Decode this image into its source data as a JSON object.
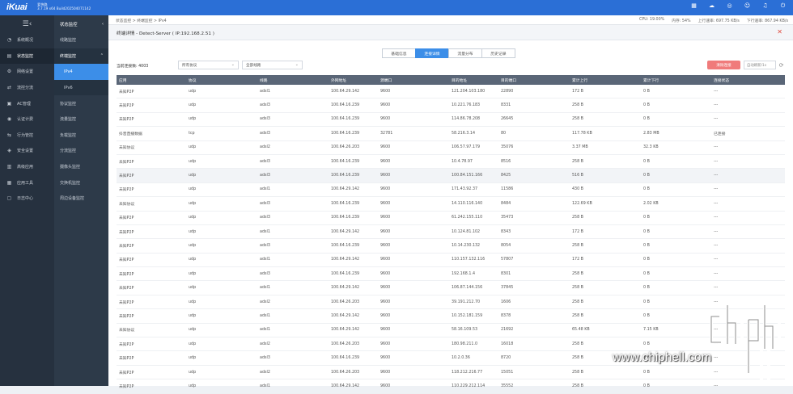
{
  "topbar": {
    "logo": "iKuai",
    "brand_line1": "爱快路",
    "brand_line2": "3.7.19 x64 Build202504071142",
    "icons": [
      "grid-icon",
      "cloud-icon",
      "globe-icon",
      "user-icon",
      "bell-icon",
      "power-icon"
    ]
  },
  "leftnav": {
    "toggle": "☰‹",
    "items": [
      {
        "label": "系统概况",
        "icon": "dashboard-icon"
      },
      {
        "label": "状态监控",
        "icon": "chart-icon",
        "active": true
      },
      {
        "label": "网络设置",
        "icon": "network-icon"
      },
      {
        "label": "流控分流",
        "icon": "flow-icon"
      },
      {
        "label": "AC管理",
        "icon": "ac-icon"
      },
      {
        "label": "认证计费",
        "icon": "auth-icon"
      },
      {
        "label": "行为管控",
        "icon": "behavior-icon"
      },
      {
        "label": "安全设置",
        "icon": "shield-icon"
      },
      {
        "label": "高级应用",
        "icon": "advanced-icon"
      },
      {
        "label": "应用工具",
        "icon": "tools-icon"
      },
      {
        "label": "日志中心",
        "icon": "log-icon"
      }
    ]
  },
  "subnav": {
    "title": "状态监控",
    "collapse": "‹",
    "items": [
      {
        "label": "线路监控",
        "kind": "normal"
      },
      {
        "label": "终端监控",
        "kind": "open",
        "caret": "⌃"
      },
      {
        "label": "IPv4",
        "kind": "sel"
      },
      {
        "label": "IPv6",
        "kind": "child"
      },
      {
        "label": "协议监控",
        "kind": "normal"
      },
      {
        "label": "流量监控",
        "kind": "normal"
      },
      {
        "label": "负载监控",
        "kind": "normal"
      },
      {
        "label": "分流监控",
        "kind": "normal"
      },
      {
        "label": "摄像头监控",
        "kind": "normal"
      },
      {
        "label": "交换机监控",
        "kind": "normal"
      },
      {
        "label": "周边设备监控",
        "kind": "normal"
      }
    ]
  },
  "breadcrumb": {
    "text": "状态监控 > 终端监控 > IPv4"
  },
  "stats": {
    "cpu": "CPU: 19.00%",
    "mem": "内存: 54%",
    "up": "上行速率: 697.75 KB/s",
    "down": "下行速率: 867.94 KB/s"
  },
  "panel": {
    "title": "终端详情 - Detect-Server ( IP:192.168.2.51 )",
    "close": "✕",
    "tabs": [
      {
        "label": "基础信息"
      },
      {
        "label": "连接详情",
        "active": true
      },
      {
        "label": "流量分布"
      },
      {
        "label": "历史记录"
      }
    ],
    "filters": {
      "conn_count": "当前连接数: 4003",
      "protocol_select": "所有协议",
      "line_select": "全部线路",
      "clear_button": "清除连接",
      "refresh_select": "自动刷新/1s",
      "refresh_icon": "⟳"
    }
  },
  "table": {
    "headers": [
      "应用",
      "协议",
      "线路",
      "外网地址",
      "源端口",
      "目的地址",
      "目的端口",
      "累计上行",
      "累计下行",
      "连接状态"
    ],
    "rows": [
      [
        "未知P2P",
        "udp",
        "adsl1",
        "100.64.29.142",
        "9600",
        "121.204.103.180",
        "22890",
        "172 B",
        "0 B",
        "---"
      ],
      [
        "未知P2P",
        "udp",
        "adsl3",
        "100.64.16.239",
        "9600",
        "10.221.76.183",
        "8331",
        "258 B",
        "0 B",
        "---"
      ],
      [
        "未知P2P",
        "udp",
        "adsl3",
        "100.64.16.239",
        "9600",
        "114.86.78.208",
        "26645",
        "258 B",
        "0 B",
        "---"
      ],
      [
        "抖音直播数据",
        "tcp",
        "adsl3",
        "100.64.16.239",
        "32781",
        "58.216.3.14",
        "80",
        "117.78 KB",
        "2.83 MB",
        "已连接"
      ],
      [
        "未知协议",
        "udp",
        "adsl2",
        "100.64.26.203",
        "9600",
        "106.57.97.179",
        "35076",
        "3.37 MB",
        "32.3 KB",
        "---"
      ],
      [
        "未知P2P",
        "udp",
        "adsl3",
        "100.64.16.239",
        "9600",
        "10.4.78.97",
        "8516",
        "258 B",
        "0 B",
        "---"
      ],
      [
        "未知P2P",
        "udp",
        "adsl3",
        "100.64.16.239",
        "9600",
        "100.84.151.166",
        "8425",
        "516 B",
        "0 B",
        "---"
      ],
      [
        "未知P2P",
        "udp",
        "adsl1",
        "100.64.29.142",
        "9600",
        "171.43.92.37",
        "11586",
        "430 B",
        "0 B",
        "---"
      ],
      [
        "未知协议",
        "udp",
        "adsl3",
        "100.64.16.239",
        "9600",
        "14.110.116.140",
        "8484",
        "122.69 KB",
        "2.02 KB",
        "---"
      ],
      [
        "未知P2P",
        "udp",
        "adsl3",
        "100.64.16.239",
        "9600",
        "61.242.155.110",
        "35473",
        "258 B",
        "0 B",
        "---"
      ],
      [
        "未知P2P",
        "udp",
        "adsl1",
        "100.64.29.142",
        "9600",
        "10.124.81.102",
        "8343",
        "172 B",
        "0 B",
        "---"
      ],
      [
        "未知P2P",
        "udp",
        "adsl3",
        "100.64.16.239",
        "9600",
        "10.14.230.132",
        "8054",
        "258 B",
        "0 B",
        "---"
      ],
      [
        "未知P2P",
        "udp",
        "adsl1",
        "100.64.29.142",
        "9600",
        "110.157.132.116",
        "57807",
        "172 B",
        "0 B",
        "---"
      ],
      [
        "未知P2P",
        "udp",
        "adsl3",
        "100.64.16.239",
        "9600",
        "192.168.1.4",
        "8301",
        "258 B",
        "0 B",
        "---"
      ],
      [
        "未知P2P",
        "udp",
        "adsl1",
        "100.64.29.142",
        "9600",
        "106.87.144.156",
        "37845",
        "258 B",
        "0 B",
        "---"
      ],
      [
        "未知P2P",
        "udp",
        "adsl2",
        "100.64.26.203",
        "9600",
        "39.191.212.70",
        "1606",
        "258 B",
        "0 B",
        "---"
      ],
      [
        "未知P2P",
        "udp",
        "adsl1",
        "100.64.29.142",
        "9600",
        "10.152.181.159",
        "8378",
        "258 B",
        "0 B",
        "---"
      ],
      [
        "未知协议",
        "udp",
        "adsl1",
        "100.64.29.142",
        "9600",
        "58.16.109.53",
        "21692",
        "65.48 KB",
        "7.15 KB",
        "---"
      ],
      [
        "未知P2P",
        "udp",
        "adsl2",
        "100.64.26.203",
        "9600",
        "180.98.211.0",
        "16018",
        "258 B",
        "0 B",
        "---"
      ],
      [
        "未知P2P",
        "udp",
        "adsl3",
        "100.64.16.239",
        "9600",
        "10.2.0.36",
        "8720",
        "258 B",
        "0 B",
        "---"
      ],
      [
        "未知P2P",
        "udp",
        "adsl2",
        "100.64.26.203",
        "9600",
        "118.212.216.77",
        "15051",
        "258 B",
        "0 B",
        "---"
      ],
      [
        "未知P2P",
        "udp",
        "adsl1",
        "100.64.29.142",
        "9600",
        "110.229.212.114",
        "35552",
        "258 B",
        "0 B",
        "---"
      ]
    ],
    "highlight_row": 6
  },
  "watermark": {
    "text": "chip hell",
    "url": "www.chiphell.com"
  },
  "colors": {
    "topbar": "#2b6fd6",
    "accent": "#3c8ee8",
    "danger": "#f07b7b",
    "header_row": "#5a6677",
    "leftnav": "#26313f"
  }
}
